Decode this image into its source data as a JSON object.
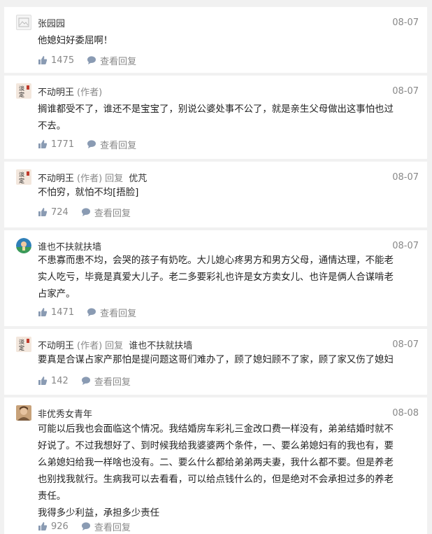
{
  "comments": [
    {
      "user": "张园园",
      "author_tag": "",
      "reply_word": "",
      "reply_to": "",
      "date": "08-07",
      "lines": [
        "他媳妇好委屈啊！"
      ],
      "likes": "1475",
      "reply_label": "查看回复",
      "avatar_icon": "broken-image-icon"
    },
    {
      "user": "不动明王",
      "author_tag": "(作者)",
      "reply_word": "",
      "reply_to": "",
      "date": "08-07",
      "lines": [
        "搁谁都受不了，谁还不是宝宝了，别说公婆处事不公了，就是亲生父母做出这事怕也过",
        "不去。"
      ],
      "likes": "1771",
      "reply_label": "查看回复",
      "avatar_icon": "calligraphy-avatar-icon"
    },
    {
      "user": "不动明王",
      "author_tag": "(作者)",
      "reply_word": "回复",
      "reply_to": "优芃",
      "date": "08-07",
      "lines": [
        "不怕穷，就怕不均[捂脸]"
      ],
      "likes": "724",
      "reply_label": "查看回复",
      "avatar_icon": "calligraphy-avatar-icon"
    },
    {
      "user": "谁也不扶就扶墙",
      "author_tag": "",
      "reply_word": "",
      "reply_to": "",
      "date": "08-07",
      "lines": [
        "不患寡而患不均，会哭的孩子有奶吃。大儿媳心疼男方和男方父母，通情达理，不能老",
        "实人吃亏，毕竟是真爱大儿子。老二多要彩礼也许是女方卖女儿、也许是俩人合谋啃老",
        "占家产。"
      ],
      "likes": "1471",
      "reply_label": "查看回复",
      "avatar_icon": "cartoon-avatar-icon"
    },
    {
      "user": "不动明王",
      "author_tag": "(作者)",
      "reply_word": "回复",
      "reply_to": "谁也不扶就扶墙",
      "date": "08-07",
      "lines": [
        "要真是合谋占家产那怕是提问题这哥们难办了，顾了媳妇顾不了家，顾了家又伤了媳妇"
      ],
      "likes": "142",
      "reply_label": "查看回复",
      "avatar_icon": "calligraphy-avatar-icon"
    },
    {
      "user": "非优秀女青年",
      "author_tag": "",
      "reply_word": "",
      "reply_to": "",
      "date": "08-08",
      "lines": [
        "可能以后我也会面临这个情况。我结婚房车彩礼三金改口费一样没有，弟弟结婚时就不",
        "好说了。不过我想好了、到时候我给我婆婆两个条件，一、要么弟媳妇有的我也有，要",
        "么弟媳妇给我一样啥也没有。二、要么什么都给弟弟两夫妻，我什么都不要。但是养老",
        "也别找我就行。生病我可以去看看，可以给点钱什么的，但是绝对不会承担过多的养老",
        "责任。",
        "我得多少利益，承担多少责任"
      ],
      "likes": "926",
      "reply_label": "查看回复",
      "avatar_icon": "photo-avatar-icon"
    }
  ]
}
